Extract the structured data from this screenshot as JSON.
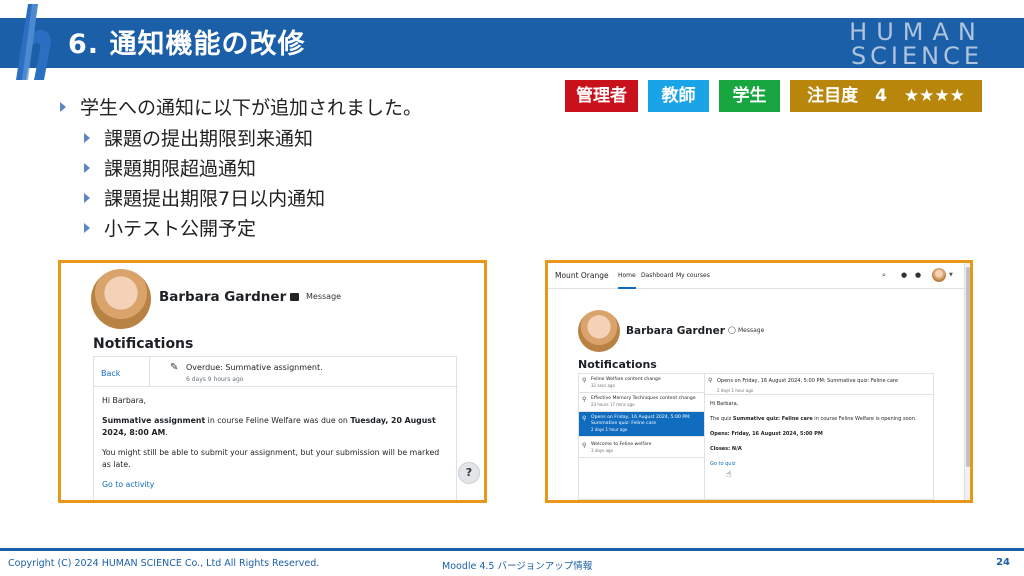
{
  "slide": {
    "title": "6. 通知機能の改修",
    "brand_line1": "HUMAN",
    "brand_line2": "SCIENCE"
  },
  "badges": {
    "admin": "管理者",
    "teacher": "教師",
    "student": "学生",
    "attention": "注目度　4　★★★★",
    "attention_level": 4,
    "colors": {
      "admin": "#c9111b",
      "teacher": "#1ba3e8",
      "student": "#17a640",
      "attention": "#b8860b"
    }
  },
  "bullets": {
    "main": "学生への通知に以下が追加されました。",
    "sub": [
      "課題の提出期限到来通知",
      "課題期限超過通知",
      "課題提出期限7日以内通知",
      "小テスト公開予定"
    ]
  },
  "shot1": {
    "name": "Barbara Gardner",
    "message": "Message",
    "heading": "Notifications",
    "back": "Back",
    "subject": "Overdue: Summative assignment.",
    "time": "6 days 9 hours ago",
    "greeting": "Hi Barbara,",
    "assignment": "Summative assignment",
    "course_text": " in course Feline Welfare was due on ",
    "due": "Tuesday, 20 August 2024, 8:00 AM",
    "period": ".",
    "note": "You might still be able to submit your assignment, but your submission will be marked as late.",
    "link": "Go to activity",
    "help": "?"
  },
  "shot2": {
    "site": "Mount Orange",
    "tabs": [
      "Home",
      "Dashboard",
      "My courses"
    ],
    "name": "Barbara Gardner",
    "message": "Message",
    "heading": "Notifications",
    "list": [
      {
        "title": "Feline Welfare content change",
        "ago": "32 secs ago"
      },
      {
        "title": "Effective Memory Techniques content change",
        "ago": "23 hours 17 mins ago"
      },
      {
        "title": "Opens on Friday, 16 August 2024, 5:00 PM: Summative quiz: Feline care",
        "ago": "2 days 1 hour ago"
      },
      {
        "title": "Welcome to Feline welfare",
        "ago": "3 days ago"
      }
    ],
    "detail": {
      "subject": "Opens on Friday, 16 August 2024, 5:00 PM: Summative quiz: Feline care",
      "time": "2 days 1 hour ago",
      "greeting": "Hi Barbara,",
      "pre": "The quiz ",
      "quiz": "Summative quiz: Feline care",
      "post": " in course Feline Welfare is opening soon.",
      "opens": "Opens: Friday, 16 August 2024, 5:00 PM",
      "closes": "Closes: N/A",
      "link": "Go to quiz"
    }
  },
  "footer": {
    "copyright": "Copyright (C) 2024 HUMAN SCIENCE Co., Ltd All Rights Reserved.",
    "center": "Moodle 4.5 バージョンアップ情報",
    "page": "24"
  }
}
